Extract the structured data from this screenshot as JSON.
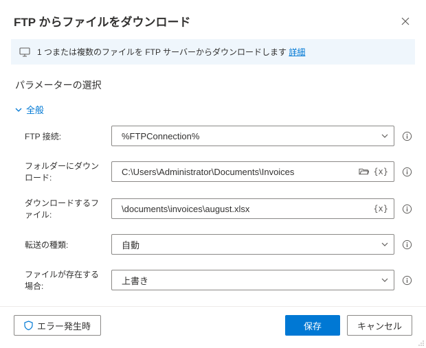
{
  "header": {
    "title": "FTP からファイルをダウンロード"
  },
  "info": {
    "text": "1 つまたは複数のファイルを FTP サーバーからダウンロードします ",
    "link": "詳細"
  },
  "section": {
    "title": "パラメーターの選択",
    "group": "全般"
  },
  "fields": {
    "ftp_connection": {
      "label": "FTP 接続:",
      "value": "%FTPConnection%"
    },
    "download_folder": {
      "label": "フォルダーにダウンロード:",
      "value": "C:\\Users\\Administrator\\Documents\\Invoices"
    },
    "files": {
      "label": "ダウンロードするファイル:",
      "value": "\\documents\\invoices\\august.xlsx"
    },
    "transfer_type": {
      "label": "転送の種類:",
      "value": "自動"
    },
    "if_exists": {
      "label": "ファイルが存在する場合:",
      "value": "上書き"
    }
  },
  "footer": {
    "on_error": "エラー発生時",
    "save": "保存",
    "cancel": "キャンセル"
  },
  "glyphs": {
    "brace": "{x}"
  }
}
